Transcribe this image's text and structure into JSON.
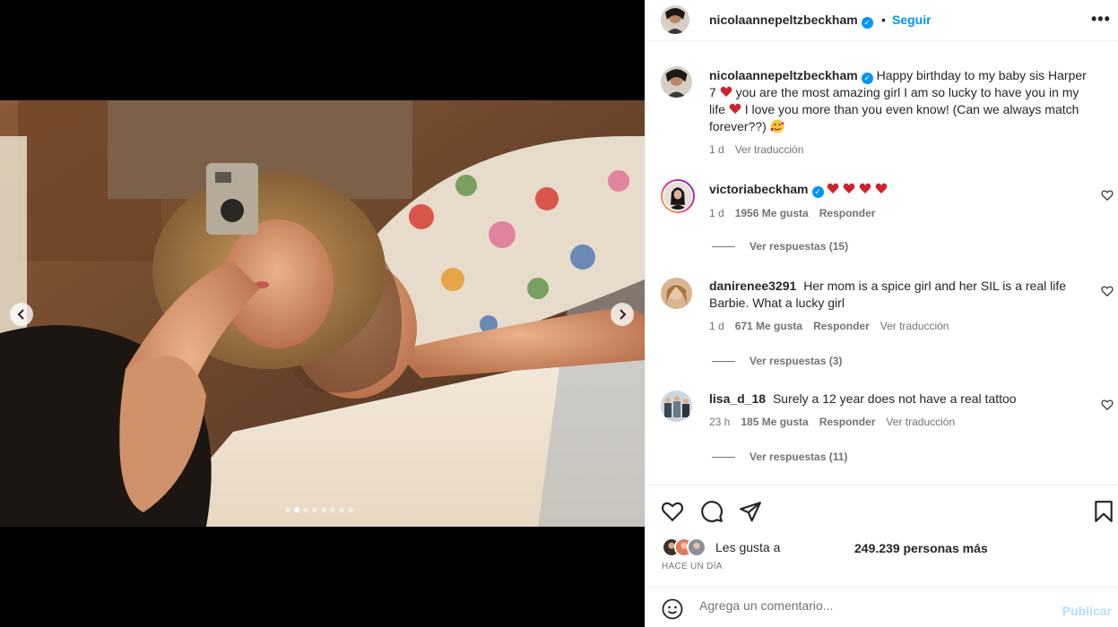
{
  "post": {
    "username": "nicolaannepeltzbeckham",
    "follow_label": "Seguir",
    "separator": "•",
    "more_label": "•••",
    "caption": "Happy birthday to my baby sis Harper 7 ❤️ you are the most amazing girl I am so lucky to have you in my life ❤️ I love you more than you even know! (Can we always match forever??) 🥰",
    "caption_parts": [
      "Happy birthday to my baby sis Harper 7",
      "you are the most amazing girl I am so lucky to have you in my life",
      "I love you more than you even know! (Can we always match forever??)"
    ],
    "caption_time": "1 d",
    "caption_translate": "Ver traducción",
    "carousel": {
      "total_slides": 8,
      "active_slide": 1
    }
  },
  "comments": [
    {
      "username": "victoriabeckham",
      "verified": true,
      "text": "❤️❤️❤️❤️",
      "time": "1 d",
      "likes": "1956 Me gusta",
      "reply": "Responder",
      "translate": "",
      "view_replies": "Ver respuestas (15)"
    },
    {
      "username": "danirenee3291",
      "verified": false,
      "text": "Her mom is a spice girl and her SIL is a real life Barbie. What a lucky girl",
      "time": "1 d",
      "likes": "671 Me gusta",
      "reply": "Responder",
      "translate": "Ver traducción",
      "view_replies": "Ver respuestas (3)"
    },
    {
      "username": "lisa_d_18",
      "verified": false,
      "text": "Surely a 12 year does not have a real tattoo",
      "time": "23 h",
      "likes": "185 Me gusta",
      "reply": "Responder",
      "translate": "Ver traducción",
      "view_replies": "Ver respuestas (11)"
    }
  ],
  "likes": {
    "prefix": "Les gusta a",
    "count": "249.239 personas más"
  },
  "time_ago": "HACE UN DÍA",
  "add_comment": {
    "placeholder": "Agrega un comentario...",
    "publish": "Publicar"
  },
  "colors": {
    "accent": "#0095f6",
    "text": "#262626",
    "muted": "#737373",
    "heart": "#c9252e",
    "publish_disabled": "#b2dffc"
  },
  "icons": [
    "chevron-left-icon",
    "chevron-right-icon",
    "more-icon",
    "verified-icon",
    "heart-icon",
    "comment-icon",
    "share-icon",
    "bookmark-icon",
    "emoji-icon"
  ]
}
